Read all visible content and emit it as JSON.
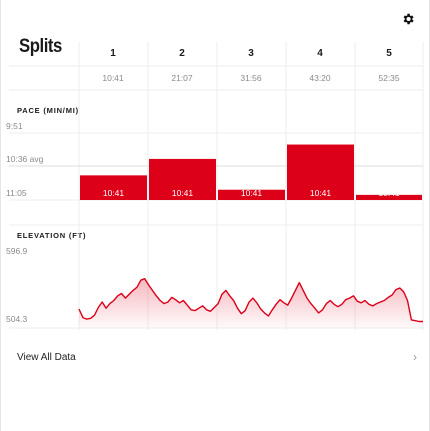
{
  "header": {
    "title": "Splits",
    "settings_icon": "gear-icon"
  },
  "splits": {
    "labels": [
      "1",
      "2",
      "3",
      "4",
      "5"
    ],
    "times": [
      "10:41",
      "21:07",
      "31:56",
      "43:20",
      "52:35"
    ]
  },
  "pace_section": {
    "label": "PACE (MIN/MI)",
    "axis_top": "9:51",
    "axis_avg": "10:36 avg",
    "axis_bottom": "11:05"
  },
  "elevation_section": {
    "label": "ELEVATION (FT)",
    "axis_top": "596.9",
    "axis_bottom": "504.3"
  },
  "footer": {
    "view_all": "View All Data",
    "chevron_icon": "chevron-right-icon"
  },
  "colors": {
    "accent": "#dc0019",
    "grid": "#eeeeee"
  },
  "chart_data": [
    {
      "type": "bar",
      "title": "PACE (MIN/MI)",
      "categories": [
        "1",
        "2",
        "3",
        "4",
        "5"
      ],
      "values_seconds": [
        641,
        625,
        655,
        611,
        660
      ],
      "data_labels": [
        "10:41",
        "10:41",
        "10:41",
        "10:41",
        "10:41"
      ],
      "y_axis_labels": [
        "9:51",
        "10:36 avg",
        "11:05"
      ],
      "y_inverted": true,
      "ylim_seconds": [
        591,
        665
      ]
    },
    {
      "type": "area",
      "title": "ELEVATION (FT)",
      "ylim": [
        504.3,
        596.9
      ],
      "values": [
        521,
        510,
        508,
        509,
        513,
        523,
        530,
        522,
        528,
        532,
        538,
        541,
        535,
        540,
        545,
        549,
        558,
        560,
        552,
        545,
        538,
        532,
        528,
        530,
        536,
        533,
        529,
        532,
        526,
        520,
        519,
        522,
        525,
        520,
        518,
        523,
        528,
        540,
        545,
        538,
        532,
        522,
        515,
        519,
        530,
        535,
        529,
        521,
        516,
        512,
        520,
        527,
        533,
        529,
        526,
        535,
        545,
        555,
        545,
        535,
        528,
        522,
        516,
        520,
        528,
        532,
        527,
        524,
        527,
        533,
        535,
        538,
        531,
        529,
        532,
        527,
        525,
        528,
        530,
        532,
        536,
        539,
        546,
        548,
        543,
        532,
        507,
        506,
        505,
        505
      ]
    }
  ]
}
